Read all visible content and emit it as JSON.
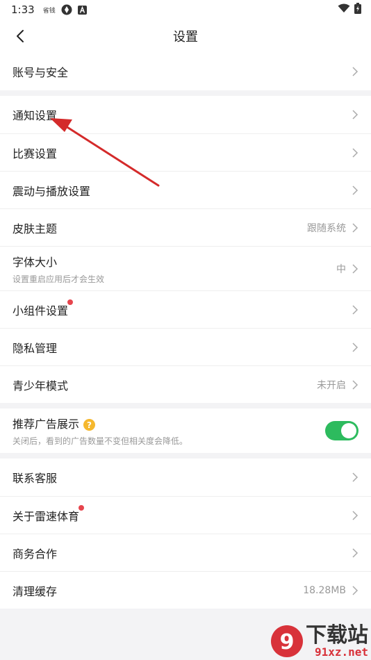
{
  "status_bar": {
    "time": "1:33",
    "notif_text": "省钱"
  },
  "header": {
    "title": "设置"
  },
  "groups": [
    [
      {
        "label": "账号与安全"
      }
    ],
    [
      {
        "label": "通知设置"
      },
      {
        "label": "比赛设置"
      },
      {
        "label": "震动与播放设置"
      },
      {
        "label": "皮肤主题",
        "value": "跟随系统"
      },
      {
        "label": "字体大小",
        "sub": "设置重启应用后才会生效",
        "value": "中"
      },
      {
        "label": "小组件设置",
        "dot": true
      },
      {
        "label": "隐私管理"
      },
      {
        "label": "青少年模式",
        "value": "未开启"
      }
    ],
    [
      {
        "label": "推荐广告展示",
        "sub": "关闭后，看到的广告数量不变但相关度会降低。",
        "toggle": "on"
      }
    ],
    [
      {
        "label": "联系客服"
      },
      {
        "label": "关于雷速体育",
        "dot": true
      },
      {
        "label": "商务合作"
      },
      {
        "label": "清理缓存",
        "value": "18.28MB"
      }
    ]
  ],
  "colors": {
    "toggle_on": "#2dbb5e",
    "red_dot": "#e6454d",
    "annotation_arrow": "#d42a2a",
    "help_badge": "#f5b82e"
  },
  "watermark": {
    "main": "下载站",
    "sub": "91xz.net",
    "logo_text": "9"
  }
}
